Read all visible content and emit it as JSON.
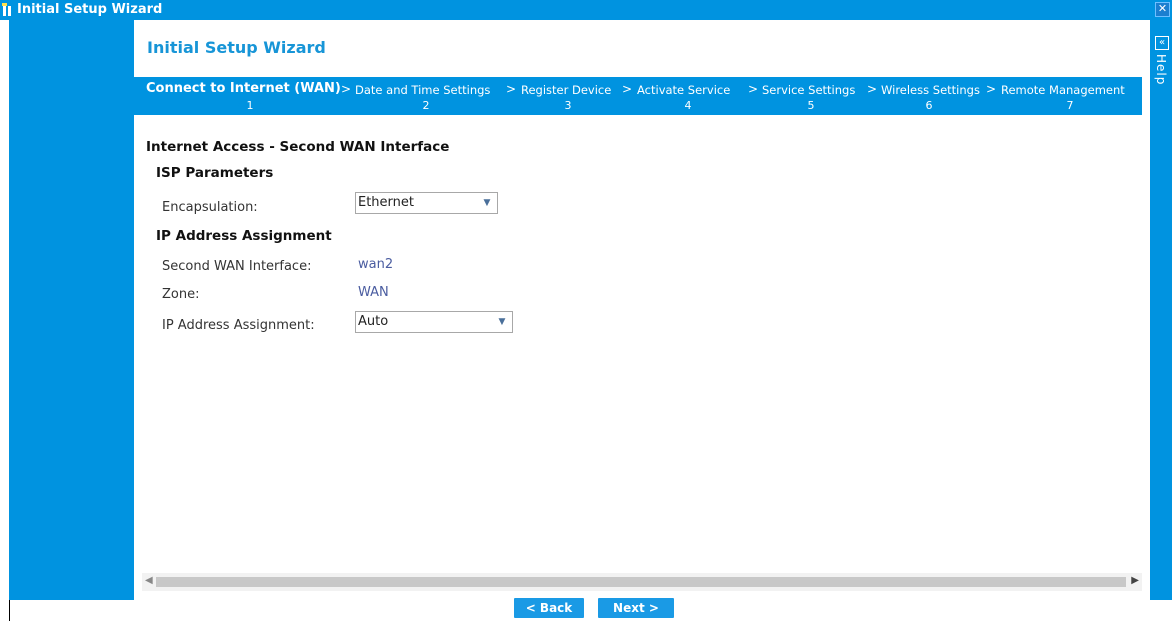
{
  "window": {
    "title": "Initial Setup Wizard",
    "close_label": "✕"
  },
  "wizard": {
    "title": "Initial Setup Wizard",
    "steps": [
      {
        "label": "Connect to Internet (WAN)",
        "number": "1",
        "active": true
      },
      {
        "label": "Date and Time Settings",
        "number": "2",
        "active": false
      },
      {
        "label": "Register Device",
        "number": "3",
        "active": false
      },
      {
        "label": "Activate Service",
        "number": "4",
        "active": false
      },
      {
        "label": "Service Settings",
        "number": "5",
        "active": false
      },
      {
        "label": "Wireless Settings",
        "number": "6",
        "active": false
      },
      {
        "label": "Remote Management",
        "number": "7",
        "active": false
      }
    ],
    "separator": ">"
  },
  "form": {
    "section_title": "Internet Access - Second WAN Interface",
    "isp": {
      "title": "ISP Parameters",
      "encapsulation_label": "Encapsulation:",
      "encapsulation_value": "Ethernet"
    },
    "ip": {
      "title": "IP Address Assignment",
      "interface_label": "Second WAN Interface:",
      "interface_value": "wan2",
      "zone_label": "Zone:",
      "zone_value": "WAN",
      "assignment_label": "IP Address Assignment:",
      "assignment_value": "Auto"
    }
  },
  "help": {
    "label": "Help",
    "collapse": "«"
  },
  "buttons": {
    "back": "< Back",
    "next": "Next >"
  },
  "colors": {
    "accent": "#0093e0",
    "title_text": "#1795d7",
    "value_text": "#4a5ca0"
  },
  "icons": {
    "app": "wizard-icon",
    "close": "close-icon",
    "dropdown": "chevron-down-icon",
    "collapse": "double-chevron-left-icon"
  }
}
